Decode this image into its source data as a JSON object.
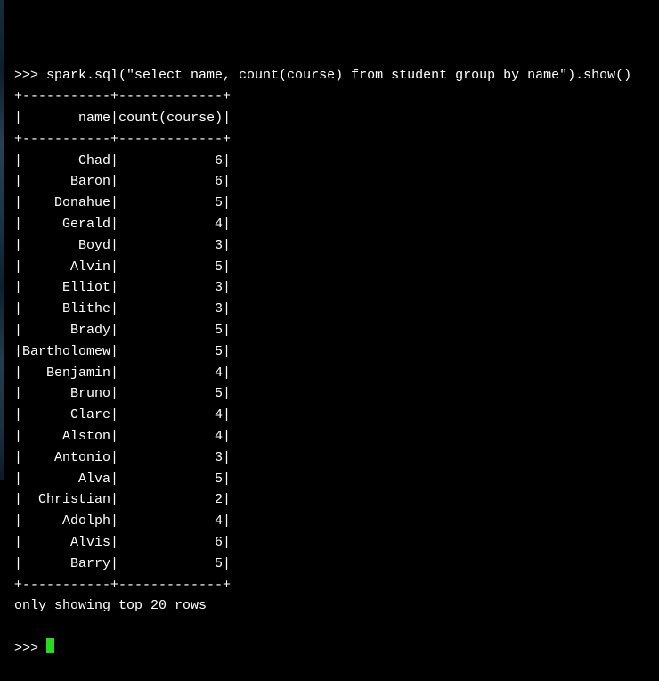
{
  "prompt_symbol": ">>> ",
  "command": "spark.sql(\"select name, count(course) from student group by name\").show()",
  "table": {
    "border_top": "+-----------+-------------+",
    "header_left": "       name",
    "header_right": "count(course)",
    "border_mid": "+-----------+-------------+",
    "rows": [
      {
        "name": "       Chad",
        "count": "            6"
      },
      {
        "name": "      Baron",
        "count": "            6"
      },
      {
        "name": "    Donahue",
        "count": "            5"
      },
      {
        "name": "     Gerald",
        "count": "            4"
      },
      {
        "name": "       Boyd",
        "count": "            3"
      },
      {
        "name": "      Alvin",
        "count": "            5"
      },
      {
        "name": "     Elliot",
        "count": "            3"
      },
      {
        "name": "     Blithe",
        "count": "            3"
      },
      {
        "name": "      Brady",
        "count": "            5"
      },
      {
        "name": "Bartholomew",
        "count": "            5"
      },
      {
        "name": "   Benjamin",
        "count": "            4"
      },
      {
        "name": "      Bruno",
        "count": "            5"
      },
      {
        "name": "      Clare",
        "count": "            4"
      },
      {
        "name": "     Alston",
        "count": "            4"
      },
      {
        "name": "    Antonio",
        "count": "            3"
      },
      {
        "name": "       Alva",
        "count": "            5"
      },
      {
        "name": "  Christian",
        "count": "            2"
      },
      {
        "name": "     Adolph",
        "count": "            4"
      },
      {
        "name": "      Alvis",
        "count": "            6"
      },
      {
        "name": "      Barry",
        "count": "            5"
      }
    ],
    "border_bottom": "+-----------+-------------+"
  },
  "footer_message": "only showing top 20 rows",
  "chart_data": {
    "type": "table",
    "title": "count(course) grouped by name",
    "columns": [
      "name",
      "count(course)"
    ],
    "rows": [
      [
        "Chad",
        6
      ],
      [
        "Baron",
        6
      ],
      [
        "Donahue",
        5
      ],
      [
        "Gerald",
        4
      ],
      [
        "Boyd",
        3
      ],
      [
        "Alvin",
        5
      ],
      [
        "Elliot",
        3
      ],
      [
        "Blithe",
        3
      ],
      [
        "Brady",
        5
      ],
      [
        "Bartholomew",
        5
      ],
      [
        "Benjamin",
        4
      ],
      [
        "Bruno",
        5
      ],
      [
        "Clare",
        4
      ],
      [
        "Alston",
        4
      ],
      [
        "Antonio",
        3
      ],
      [
        "Alva",
        5
      ],
      [
        "Christian",
        2
      ],
      [
        "Adolph",
        4
      ],
      [
        "Alvis",
        6
      ],
      [
        "Barry",
        5
      ]
    ]
  }
}
